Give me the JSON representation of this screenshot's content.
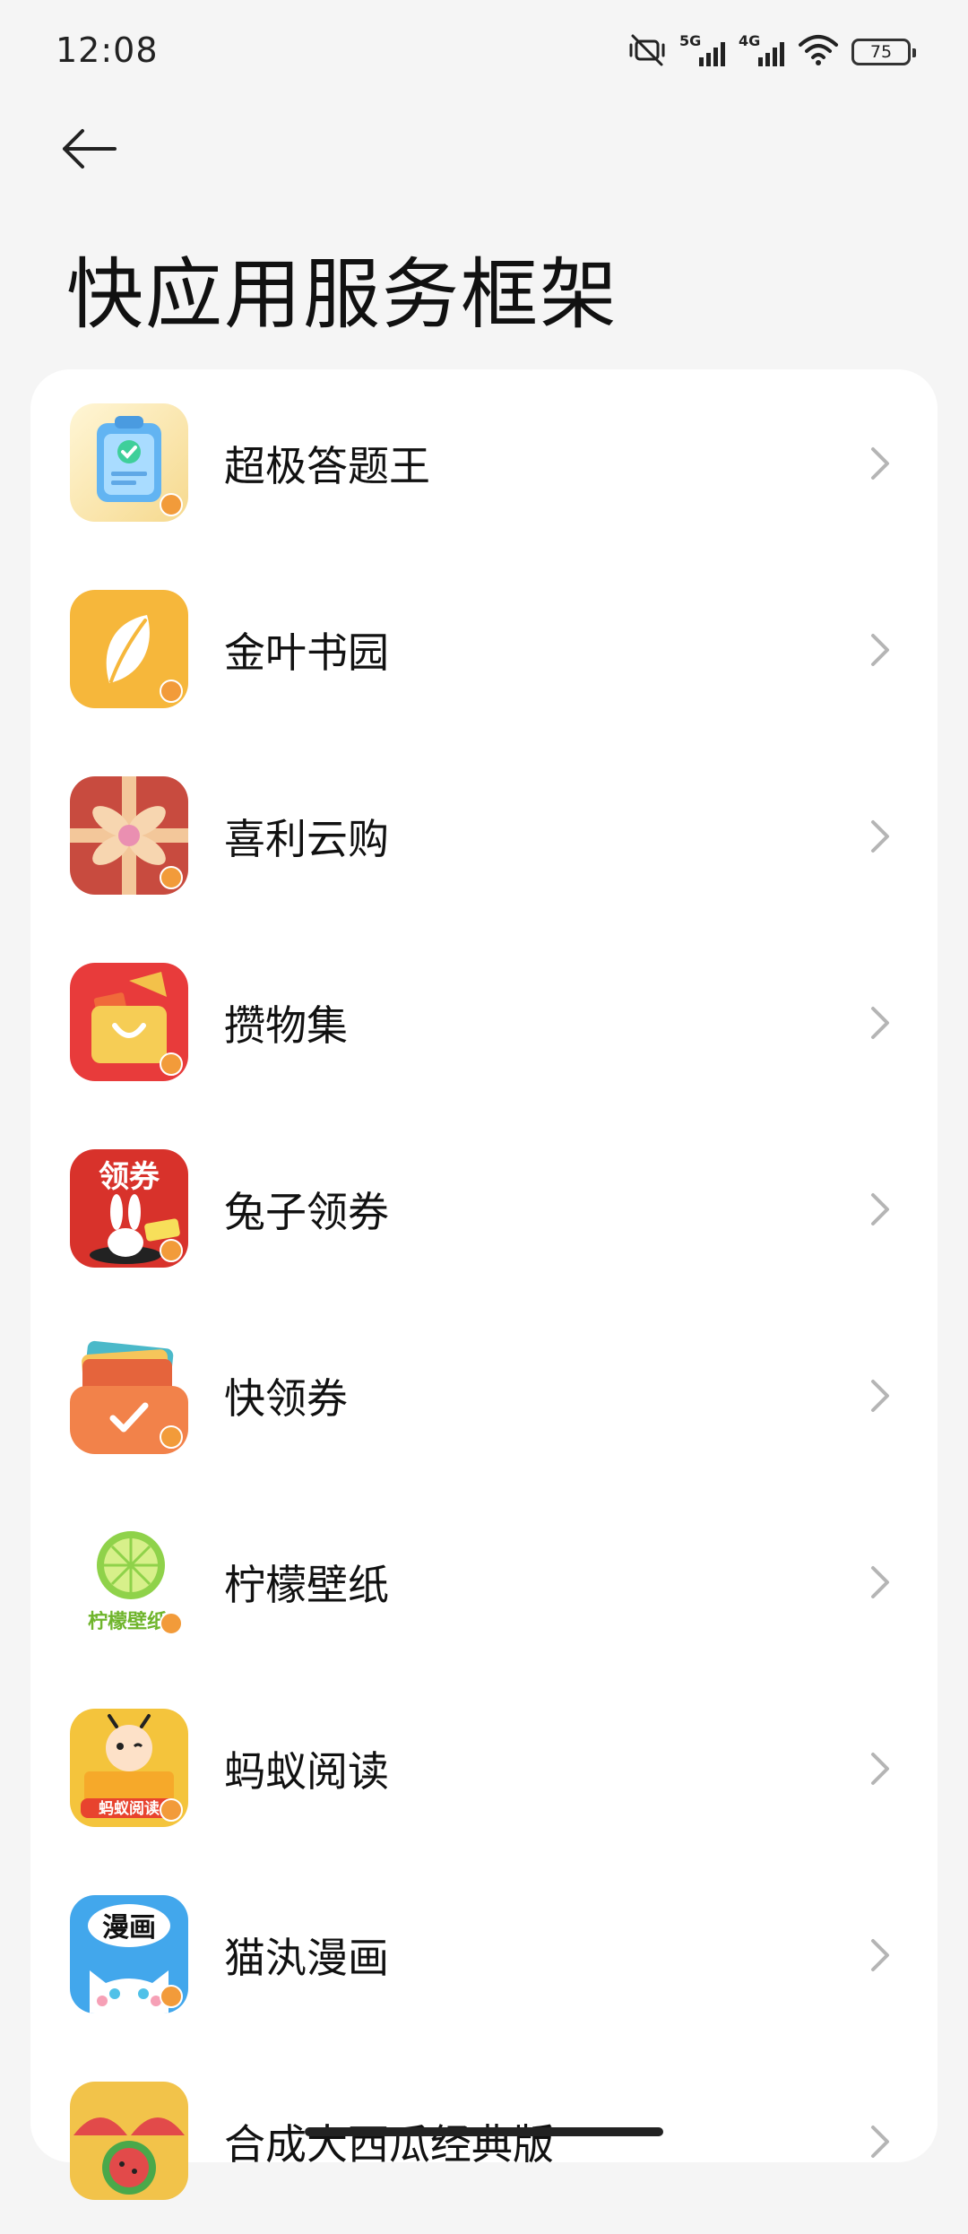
{
  "status_bar": {
    "time": "12:08",
    "signal_1_label": "5G",
    "signal_2_label": "4G",
    "battery": "75"
  },
  "header": {
    "title": "快应用服务框架"
  },
  "apps": [
    {
      "name": "超极答题王",
      "icon": "clipboard-check-icon"
    },
    {
      "name": "金叶书园",
      "icon": "leaf-icon"
    },
    {
      "name": "喜利云购",
      "icon": "gift-bow-icon"
    },
    {
      "name": "攒物集",
      "icon": "shopping-bag-icon"
    },
    {
      "name": "兔子领券",
      "icon": "rabbit-coupon-icon"
    },
    {
      "name": "快领券",
      "icon": "wallet-check-icon"
    },
    {
      "name": "柠檬壁纸",
      "icon": "lime-icon",
      "icon_text": "柠檬壁纸"
    },
    {
      "name": "蚂蚁阅读",
      "icon": "ant-reading-icon",
      "icon_text": "蚂蚁阅读"
    },
    {
      "name": "猫汍漫画",
      "icon": "cat-comic-icon",
      "icon_text": "漫画"
    },
    {
      "name": "合成大西瓜经典版",
      "icon": "watermelon-icon"
    }
  ]
}
